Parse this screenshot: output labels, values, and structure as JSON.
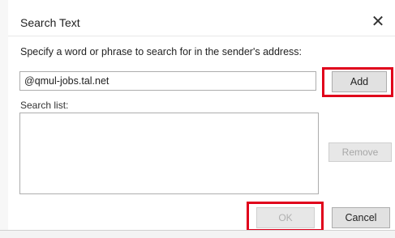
{
  "dialog": {
    "title": "Search Text",
    "close_glyph": "✕",
    "prompt": "Specify a word or phrase to search for in the sender's address:",
    "input_value": "@qmul-jobs.tal.net",
    "add_label": "Add",
    "search_list_label": "Search list:",
    "search_list_items": [],
    "remove_label": "Remove",
    "ok_label": "OK",
    "cancel_label": "Cancel"
  },
  "colors": {
    "highlight": "#e0001b",
    "disabled_text": "#a7a7a7"
  },
  "icons": {
    "close": "close-icon"
  }
}
